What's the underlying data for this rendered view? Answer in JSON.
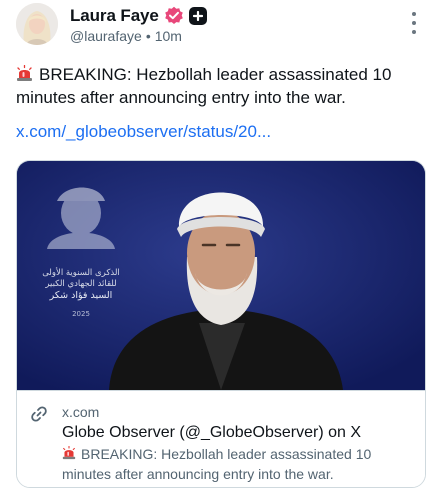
{
  "author": {
    "display_name": "Laura Faye",
    "handle": "@laurafaye",
    "separator": "•",
    "time_ago": "10m",
    "avatar_icon": "avatar-photo",
    "badges": [
      "verified-badge-icon",
      "plus-badge-icon"
    ]
  },
  "post": {
    "text": "BREAKING: Hezbollah leader assassinated 10 minutes after announcing entry into the war.",
    "prefix_icon": "siren-icon",
    "link_text": "x.com/_globeobserver/status/20..."
  },
  "card": {
    "domain": "x.com",
    "title": "Globe Observer (@_GlobeObserver) on X",
    "description": "BREAKING: Hezbollah leader assassinated 10 minutes after announcing entry into the war.",
    "image_poster_text": [
      "الذكرى السنوية الأولى",
      "للقائد الجهادي الكبير",
      "السيد فؤاد شكر",
      "2025"
    ]
  },
  "colors": {
    "link": "#1d6ff2",
    "verified_badge": "#e8477a",
    "card_image_bg": "#15226b",
    "secondary_text": "#536471"
  }
}
